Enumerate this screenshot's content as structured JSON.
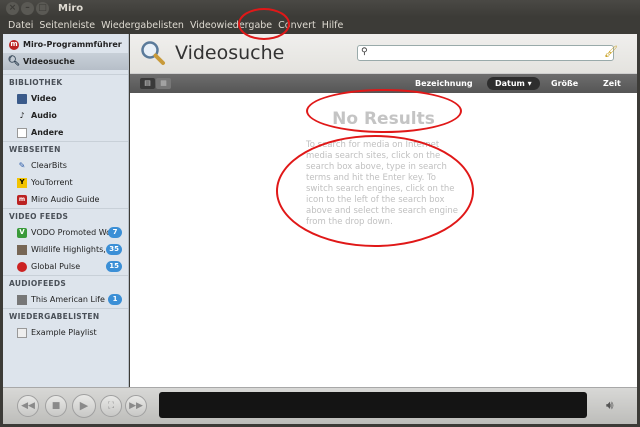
{
  "window": {
    "title": "Miro"
  },
  "menu": [
    "Datei",
    "Seitenleiste",
    "Wiedergabelisten",
    "Videowiedergabe",
    "Convert",
    "Hilfe"
  ],
  "sidebar": {
    "top": [
      {
        "label": "Miro-Programmführer",
        "icon": "miro-icon"
      },
      {
        "label": "Videosuche",
        "icon": "search-icon",
        "selected": true
      }
    ],
    "bibliothek": {
      "heading": "BIBLIOTHEK",
      "items": [
        {
          "label": "Video",
          "icon": "video-icon"
        },
        {
          "label": "Audio",
          "icon": "audio-icon"
        },
        {
          "label": "Andere",
          "icon": "document-icon"
        }
      ]
    },
    "webseiten": {
      "heading": "WEBSEITEN",
      "items": [
        {
          "label": "ClearBits",
          "icon": "clearbits-icon"
        },
        {
          "label": "YouTorrent",
          "icon": "youtorrent-icon"
        },
        {
          "label": "Miro Audio Guide",
          "icon": "miro-guide-icon"
        }
      ]
    },
    "videofeeds": {
      "heading": "VIDEO FEEDS",
      "items": [
        {
          "label": "VODO Promoted Wor",
          "badge": "7",
          "icon": "vodo-icon"
        },
        {
          "label": "Wildlife Highlights,",
          "badge": "35",
          "icon": "wildlife-icon"
        },
        {
          "label": "Global Pulse",
          "badge": "15",
          "icon": "globalpulse-icon"
        }
      ]
    },
    "audiofeeds": {
      "heading": "AUDIOFEEDS",
      "items": [
        {
          "label": "This American Life",
          "badge": "1",
          "icon": "podcast-icon"
        }
      ]
    },
    "wiedergabelisten": {
      "heading": "WIEDERGABELISTEN",
      "items": [
        {
          "label": "Example Playlist",
          "icon": "playlist-icon"
        }
      ]
    }
  },
  "main": {
    "title": "Videosuche",
    "search": {
      "value": "",
      "placeholder": ""
    },
    "columns": {
      "name": "Bezeichnung",
      "date": "Datum ▾",
      "size": "Größe",
      "time": "Zeit"
    },
    "no_results": "No Results",
    "help": "To search for media on Internet media search sites, click on the search box above, type in search terms and hit the Enter key.  To switch search engines, click on the icon to the left of the search box above and select the search engine from the drop down."
  },
  "colors": {
    "badge": "#3b8fd6",
    "annotation": "#e01818",
    "sidebar_bg": "#dde4ec"
  }
}
